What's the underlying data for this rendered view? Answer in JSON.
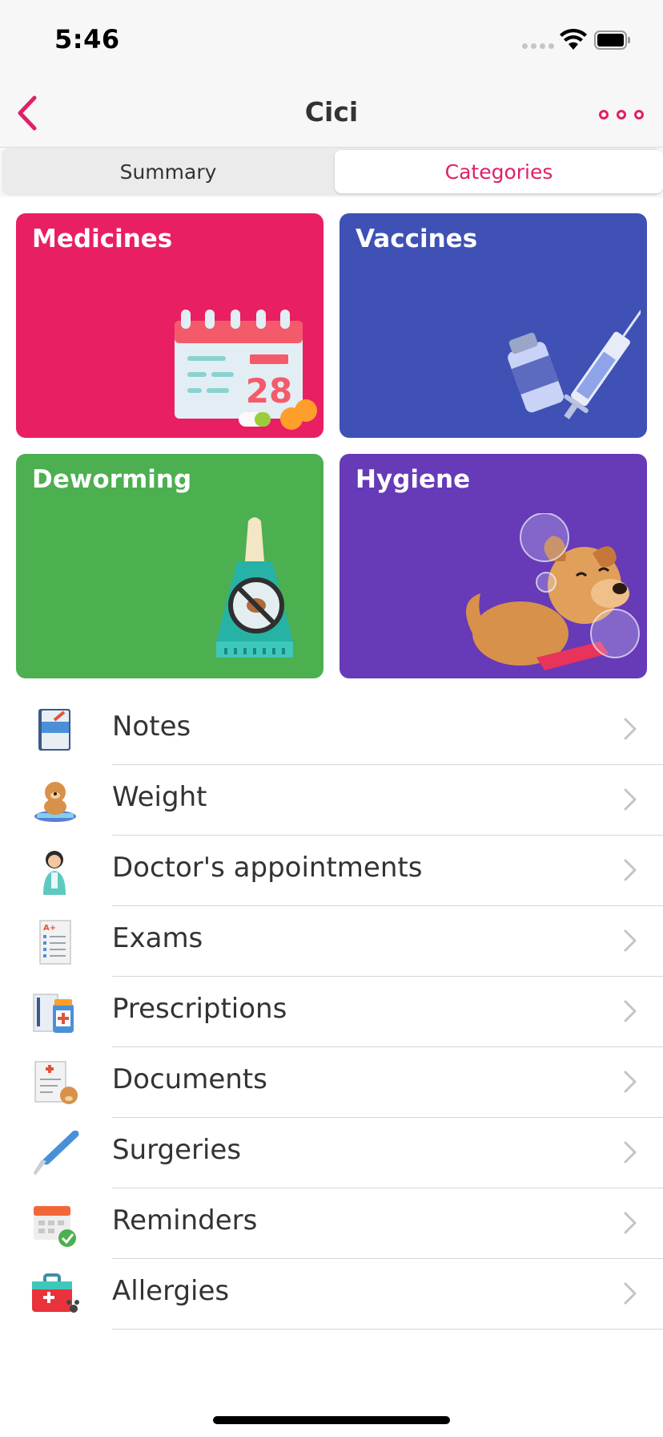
{
  "status_bar": {
    "time": "5:46"
  },
  "nav": {
    "title": "Cici"
  },
  "segments": {
    "summary": "Summary",
    "categories": "Categories"
  },
  "cards": {
    "medicines": {
      "title": "Medicines",
      "illustration": "calendar-pills-icon",
      "color": "#e91f63",
      "calendar_day": "28"
    },
    "vaccines": {
      "title": "Vaccines",
      "illustration": "vaccine-syringe-icon",
      "color": "#3f51b5"
    },
    "deworming": {
      "title": "Deworming",
      "illustration": "flea-treatment-tube-icon",
      "color": "#4caf50"
    },
    "hygiene": {
      "title": "Hygiene",
      "illustration": "dog-bubbles-icon",
      "color": "#673ab7"
    }
  },
  "list": [
    {
      "label": "Notes",
      "icon": "notebook-icon"
    },
    {
      "label": "Weight",
      "icon": "dog-scale-icon"
    },
    {
      "label": "Doctor's appointments",
      "icon": "doctor-icon"
    },
    {
      "label": "Exams",
      "icon": "exam-sheet-icon"
    },
    {
      "label": "Prescriptions",
      "icon": "prescription-icon"
    },
    {
      "label": "Documents",
      "icon": "document-icon"
    },
    {
      "label": "Surgeries",
      "icon": "scalpel-icon"
    },
    {
      "label": "Reminders",
      "icon": "calendar-check-icon"
    },
    {
      "label": "Allergies",
      "icon": "first-aid-kit-icon"
    }
  ],
  "colors": {
    "accent": "#e0206a"
  }
}
